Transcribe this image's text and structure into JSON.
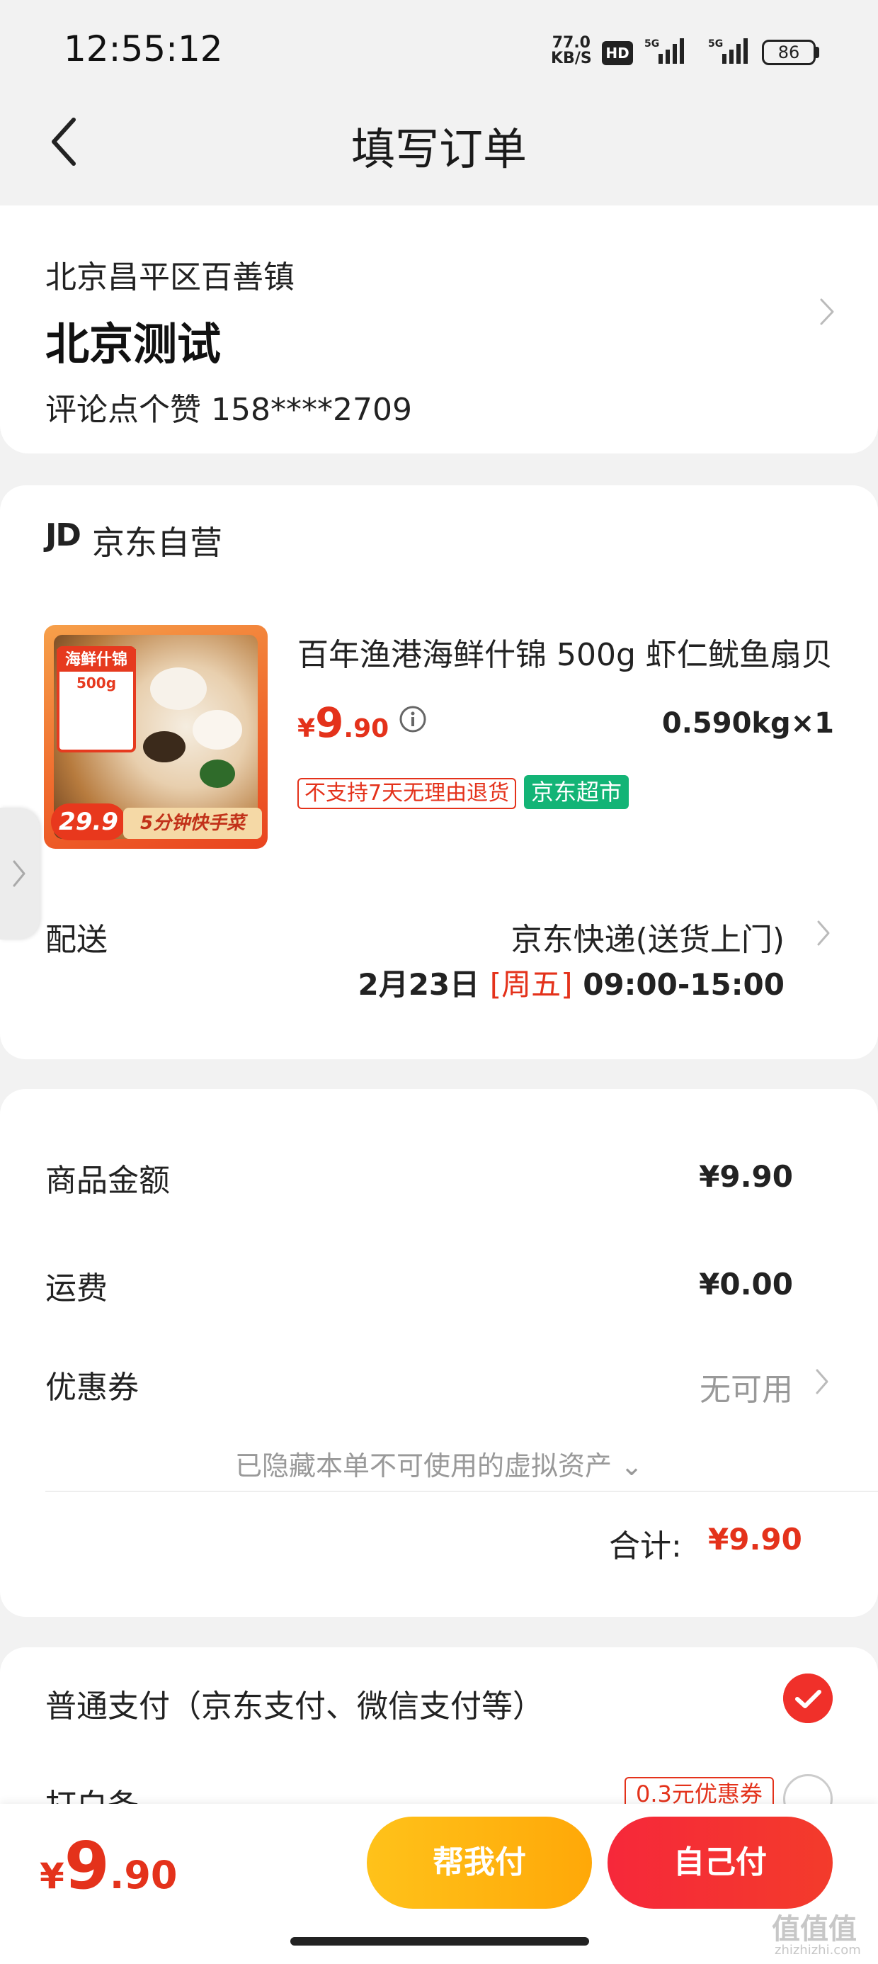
{
  "status_bar": {
    "time": "12:55:12",
    "net_speed_value": "77.0",
    "net_speed_unit": "KB/S",
    "hd_label": "HD",
    "signal_label_1": "5G",
    "signal_label_2": "5G",
    "battery": "86"
  },
  "header": {
    "title": "填写订单",
    "back_icon": "chevron-left-icon"
  },
  "address": {
    "region": "北京昌平区百善镇",
    "name": "北京测试",
    "contact": "评论点个赞  158****2709"
  },
  "store": {
    "logo_text": "JD",
    "name": "京东自营"
  },
  "product": {
    "title": "百年渔港海鲜什锦 500g 虾仁鱿鱼扇贝",
    "price_currency": "¥",
    "price_int": "9",
    "price_dec": ".90",
    "weight_qty": "0.590kg×1",
    "tag_no_return": "不支持7天无理由退货",
    "tag_market": "京东超市",
    "thumb_tag_title": "海鲜什锦",
    "thumb_tag_sub": "500g",
    "thumb_price": "29.9",
    "thumb_slogan": "5分钟快手菜"
  },
  "shipping": {
    "label": "配送",
    "method": "京东快递(送货上门)",
    "date": "2月23日",
    "weekday": "[周五]",
    "time_window": "09:00-15:00"
  },
  "summary": {
    "goods_label": "商品金额",
    "goods_value": "¥9.90",
    "freight_label": "运费",
    "freight_value": "¥0.00",
    "coupon_label": "优惠券",
    "coupon_value": "无可用",
    "hidden_note": "已隐藏本单不可使用的虚拟资产 ⌄",
    "total_label": "合计:",
    "total_value": "¥9.90"
  },
  "payment": {
    "normal_label": "普通支付（京东支付、微信支付等）",
    "baitiao_label": "打白条",
    "baitiao_coupon": "0.3元优惠券"
  },
  "bottom_bar": {
    "price_currency": "¥",
    "price_int": "9",
    "price_dec": ".90",
    "help_pay": "帮我付",
    "self_pay": "自己付"
  },
  "watermark": {
    "main": "值值值",
    "sub": "zhizhizhi.com"
  },
  "colors": {
    "accent_red": "#e4321b",
    "market_green": "#13b476",
    "help_yellow": "#ffb311"
  }
}
